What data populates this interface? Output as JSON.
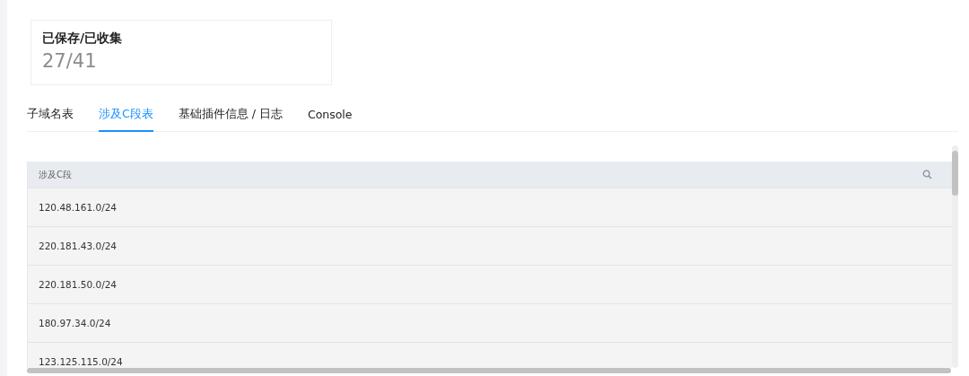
{
  "stat_card": {
    "label": "已保存/已收集",
    "value": "27/41"
  },
  "tabs": [
    {
      "label": "子域名表",
      "selected": false
    },
    {
      "label": "涉及C段表",
      "selected": true
    },
    {
      "label": "基础插件信息 / 日志",
      "selected": false
    },
    {
      "label": "Console",
      "selected": false
    }
  ],
  "table": {
    "columns": [
      "涉及C段"
    ],
    "rows": [
      "120.48.161.0/24",
      "220.181.43.0/24",
      "220.181.50.0/24",
      "180.97.34.0/24",
      "123.125.115.0/24"
    ]
  }
}
